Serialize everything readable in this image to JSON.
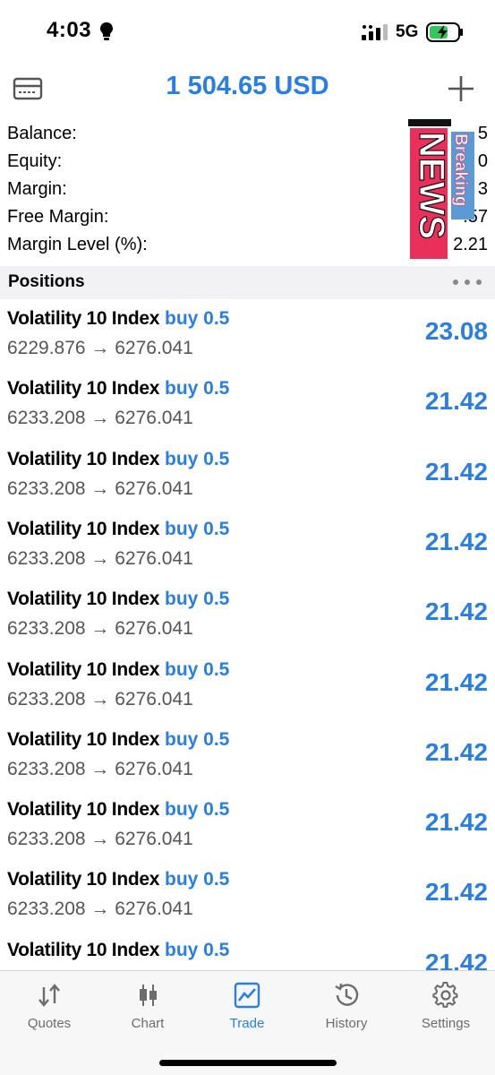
{
  "status_bar": {
    "time": "4:03",
    "network": "5G"
  },
  "header": {
    "title": "1 504.65 USD"
  },
  "summary": {
    "rows": [
      {
        "label": "Balance:",
        "value": "5"
      },
      {
        "label": "Equity:",
        "value": "0"
      },
      {
        "label": "Margin:",
        "value": "3"
      },
      {
        "label": "Free Margin:",
        "value": ".57"
      },
      {
        "label": "Margin Level (%):",
        "value": "2.21"
      }
    ]
  },
  "sticker": {
    "text_top": "Breaking",
    "text_main": "NEWS"
  },
  "positions": {
    "title": "Positions",
    "items": [
      {
        "symbol": "Volatility 10 Index",
        "side": "buy 0.5",
        "prices": "6229.876 → 6276.041",
        "profit": "23.08"
      },
      {
        "symbol": "Volatility 10 Index",
        "side": "buy 0.5",
        "prices": "6233.208 → 6276.041",
        "profit": "21.42"
      },
      {
        "symbol": "Volatility 10 Index",
        "side": "buy 0.5",
        "prices": "6233.208 → 6276.041",
        "profit": "21.42"
      },
      {
        "symbol": "Volatility 10 Index",
        "side": "buy 0.5",
        "prices": "6233.208 → 6276.041",
        "profit": "21.42"
      },
      {
        "symbol": "Volatility 10 Index",
        "side": "buy 0.5",
        "prices": "6233.208 → 6276.041",
        "profit": "21.42"
      },
      {
        "symbol": "Volatility 10 Index",
        "side": "buy 0.5",
        "prices": "6233.208 → 6276.041",
        "profit": "21.42"
      },
      {
        "symbol": "Volatility 10 Index",
        "side": "buy 0.5",
        "prices": "6233.208 → 6276.041",
        "profit": "21.42"
      },
      {
        "symbol": "Volatility 10 Index",
        "side": "buy 0.5",
        "prices": "6233.208 → 6276.041",
        "profit": "21.42"
      },
      {
        "symbol": "Volatility 10 Index",
        "side": "buy 0.5",
        "prices": "6233.208 → 6276.041",
        "profit": "21.42"
      },
      {
        "symbol": "Volatility 10 Index",
        "side": "buy 0.5",
        "prices": "",
        "profit": "21.42"
      }
    ]
  },
  "tabs": [
    {
      "label": "Quotes",
      "icon": "quotes-arrows-icon",
      "active": false
    },
    {
      "label": "Chart",
      "icon": "candlestick-icon",
      "active": false
    },
    {
      "label": "Trade",
      "icon": "trade-chart-icon",
      "active": true
    },
    {
      "label": "History",
      "icon": "history-clock-icon",
      "active": false
    },
    {
      "label": "Settings",
      "icon": "gear-icon",
      "active": false
    }
  ],
  "colors": {
    "accent": "#2a7ee3",
    "sticker_red": "#e8305a",
    "sticker_blue": "#5b9bd5"
  }
}
